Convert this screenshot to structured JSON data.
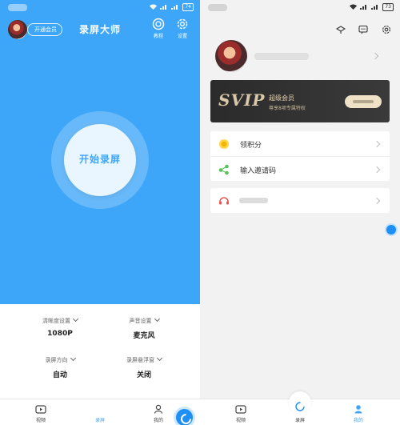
{
  "left": {
    "status": {
      "battery": "74"
    },
    "header": {
      "vip_button": "开通会员",
      "title": "录屏大师",
      "tutorial_label": "教程",
      "settings_label": "设置"
    },
    "record_button": "开始录屏",
    "settings": [
      {
        "label": "清晰度设置",
        "value": "1080P"
      },
      {
        "label": "声音设置",
        "value": "麦克风"
      },
      {
        "label": "录屏方向",
        "value": "自动"
      },
      {
        "label": "录屏悬浮窗",
        "value": "关闭"
      }
    ],
    "tabs": [
      {
        "label": "视频",
        "icon": "video-icon"
      },
      {
        "label": "录屏",
        "icon": "record-icon"
      },
      {
        "label": "我的",
        "icon": "profile-icon"
      }
    ]
  },
  "right": {
    "status": {
      "battery": "73"
    },
    "svip": {
      "logo": "SVIP",
      "title": "超级会员",
      "subtitle": "尊享8项专属特权"
    },
    "menu": [
      {
        "label": "领积分",
        "icon": "coin-icon"
      },
      {
        "label": "输入邀请码",
        "icon": "share-icon"
      }
    ],
    "tabs": [
      {
        "label": "视频",
        "icon": "video-icon"
      },
      {
        "label": "录屏",
        "icon": "record-icon"
      },
      {
        "label": "我的",
        "icon": "profile-icon"
      }
    ]
  },
  "colors": {
    "primary": "#3ea6f8",
    "accent": "#1d8ff5",
    "svip_dark": "#2b2b2b",
    "svip_gold": "#e8d4b0"
  }
}
